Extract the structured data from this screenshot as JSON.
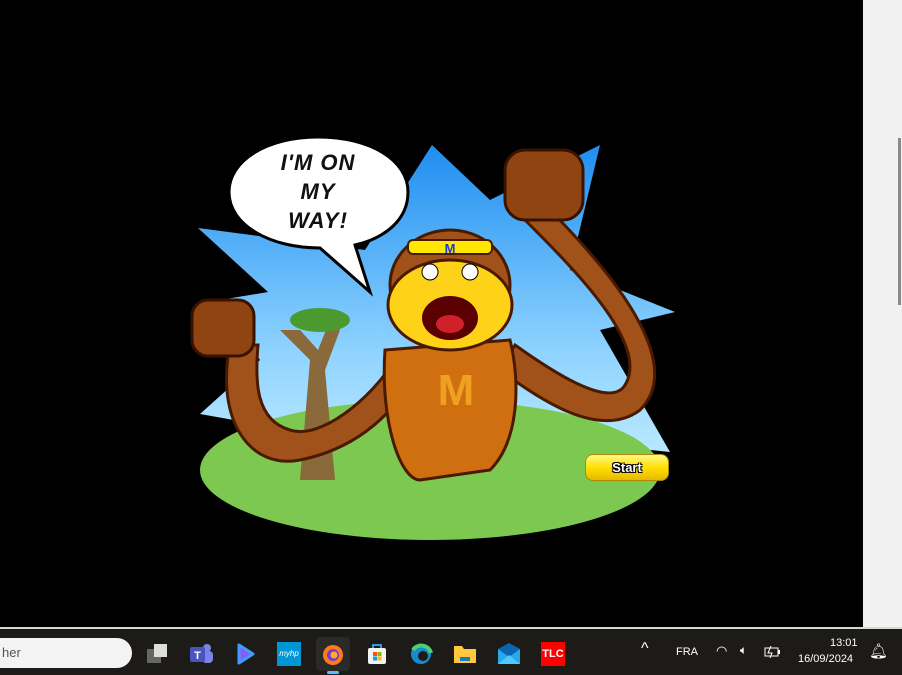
{
  "game": {
    "speech": [
      "I'M ON",
      "MY",
      "WAY!"
    ],
    "start_label": "Start",
    "headband_letter": "M",
    "chest_letter": "M"
  },
  "taskbar": {
    "search_placeholder": "her",
    "apps": [
      "task-view",
      "teams",
      "copilot",
      "myhp",
      "firefox",
      "microsoft-store",
      "edge",
      "file-explorer",
      "mail",
      "tlc"
    ],
    "tlc_label": "TLC",
    "myhp_label": "myhp",
    "language": "FRA",
    "time": "13:01",
    "date": "16/09/2024"
  },
  "colors": {
    "accent": "#4cc2ff",
    "button": "#ffe000"
  }
}
